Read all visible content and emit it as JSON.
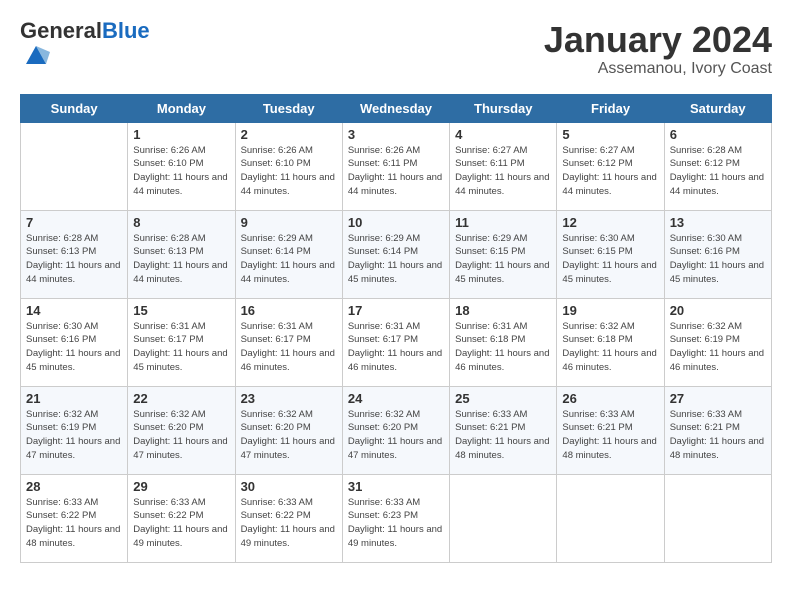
{
  "header": {
    "logo_general": "General",
    "logo_blue": "Blue",
    "month": "January 2024",
    "location": "Assemanou, Ivory Coast"
  },
  "weekdays": [
    "Sunday",
    "Monday",
    "Tuesday",
    "Wednesday",
    "Thursday",
    "Friday",
    "Saturday"
  ],
  "weeks": [
    [
      {
        "day": "",
        "info": ""
      },
      {
        "day": "1",
        "info": "Sunrise: 6:26 AM\nSunset: 6:10 PM\nDaylight: 11 hours\nand 44 minutes."
      },
      {
        "day": "2",
        "info": "Sunrise: 6:26 AM\nSunset: 6:10 PM\nDaylight: 11 hours\nand 44 minutes."
      },
      {
        "day": "3",
        "info": "Sunrise: 6:26 AM\nSunset: 6:11 PM\nDaylight: 11 hours\nand 44 minutes."
      },
      {
        "day": "4",
        "info": "Sunrise: 6:27 AM\nSunset: 6:11 PM\nDaylight: 11 hours\nand 44 minutes."
      },
      {
        "day": "5",
        "info": "Sunrise: 6:27 AM\nSunset: 6:12 PM\nDaylight: 11 hours\nand 44 minutes."
      },
      {
        "day": "6",
        "info": "Sunrise: 6:28 AM\nSunset: 6:12 PM\nDaylight: 11 hours\nand 44 minutes."
      }
    ],
    [
      {
        "day": "7",
        "info": "Sunrise: 6:28 AM\nSunset: 6:13 PM\nDaylight: 11 hours\nand 44 minutes."
      },
      {
        "day": "8",
        "info": "Sunrise: 6:28 AM\nSunset: 6:13 PM\nDaylight: 11 hours\nand 44 minutes."
      },
      {
        "day": "9",
        "info": "Sunrise: 6:29 AM\nSunset: 6:14 PM\nDaylight: 11 hours\nand 44 minutes."
      },
      {
        "day": "10",
        "info": "Sunrise: 6:29 AM\nSunset: 6:14 PM\nDaylight: 11 hours\nand 45 minutes."
      },
      {
        "day": "11",
        "info": "Sunrise: 6:29 AM\nSunset: 6:15 PM\nDaylight: 11 hours\nand 45 minutes."
      },
      {
        "day": "12",
        "info": "Sunrise: 6:30 AM\nSunset: 6:15 PM\nDaylight: 11 hours\nand 45 minutes."
      },
      {
        "day": "13",
        "info": "Sunrise: 6:30 AM\nSunset: 6:16 PM\nDaylight: 11 hours\nand 45 minutes."
      }
    ],
    [
      {
        "day": "14",
        "info": "Sunrise: 6:30 AM\nSunset: 6:16 PM\nDaylight: 11 hours\nand 45 minutes."
      },
      {
        "day": "15",
        "info": "Sunrise: 6:31 AM\nSunset: 6:17 PM\nDaylight: 11 hours\nand 45 minutes."
      },
      {
        "day": "16",
        "info": "Sunrise: 6:31 AM\nSunset: 6:17 PM\nDaylight: 11 hours\nand 46 minutes."
      },
      {
        "day": "17",
        "info": "Sunrise: 6:31 AM\nSunset: 6:17 PM\nDaylight: 11 hours\nand 46 minutes."
      },
      {
        "day": "18",
        "info": "Sunrise: 6:31 AM\nSunset: 6:18 PM\nDaylight: 11 hours\nand 46 minutes."
      },
      {
        "day": "19",
        "info": "Sunrise: 6:32 AM\nSunset: 6:18 PM\nDaylight: 11 hours\nand 46 minutes."
      },
      {
        "day": "20",
        "info": "Sunrise: 6:32 AM\nSunset: 6:19 PM\nDaylight: 11 hours\nand 46 minutes."
      }
    ],
    [
      {
        "day": "21",
        "info": "Sunrise: 6:32 AM\nSunset: 6:19 PM\nDaylight: 11 hours\nand 47 minutes."
      },
      {
        "day": "22",
        "info": "Sunrise: 6:32 AM\nSunset: 6:20 PM\nDaylight: 11 hours\nand 47 minutes."
      },
      {
        "day": "23",
        "info": "Sunrise: 6:32 AM\nSunset: 6:20 PM\nDaylight: 11 hours\nand 47 minutes."
      },
      {
        "day": "24",
        "info": "Sunrise: 6:32 AM\nSunset: 6:20 PM\nDaylight: 11 hours\nand 47 minutes."
      },
      {
        "day": "25",
        "info": "Sunrise: 6:33 AM\nSunset: 6:21 PM\nDaylight: 11 hours\nand 48 minutes."
      },
      {
        "day": "26",
        "info": "Sunrise: 6:33 AM\nSunset: 6:21 PM\nDaylight: 11 hours\nand 48 minutes."
      },
      {
        "day": "27",
        "info": "Sunrise: 6:33 AM\nSunset: 6:21 PM\nDaylight: 11 hours\nand 48 minutes."
      }
    ],
    [
      {
        "day": "28",
        "info": "Sunrise: 6:33 AM\nSunset: 6:22 PM\nDaylight: 11 hours\nand 48 minutes."
      },
      {
        "day": "29",
        "info": "Sunrise: 6:33 AM\nSunset: 6:22 PM\nDaylight: 11 hours\nand 49 minutes."
      },
      {
        "day": "30",
        "info": "Sunrise: 6:33 AM\nSunset: 6:22 PM\nDaylight: 11 hours\nand 49 minutes."
      },
      {
        "day": "31",
        "info": "Sunrise: 6:33 AM\nSunset: 6:23 PM\nDaylight: 11 hours\nand 49 minutes."
      },
      {
        "day": "",
        "info": ""
      },
      {
        "day": "",
        "info": ""
      },
      {
        "day": "",
        "info": ""
      }
    ]
  ]
}
